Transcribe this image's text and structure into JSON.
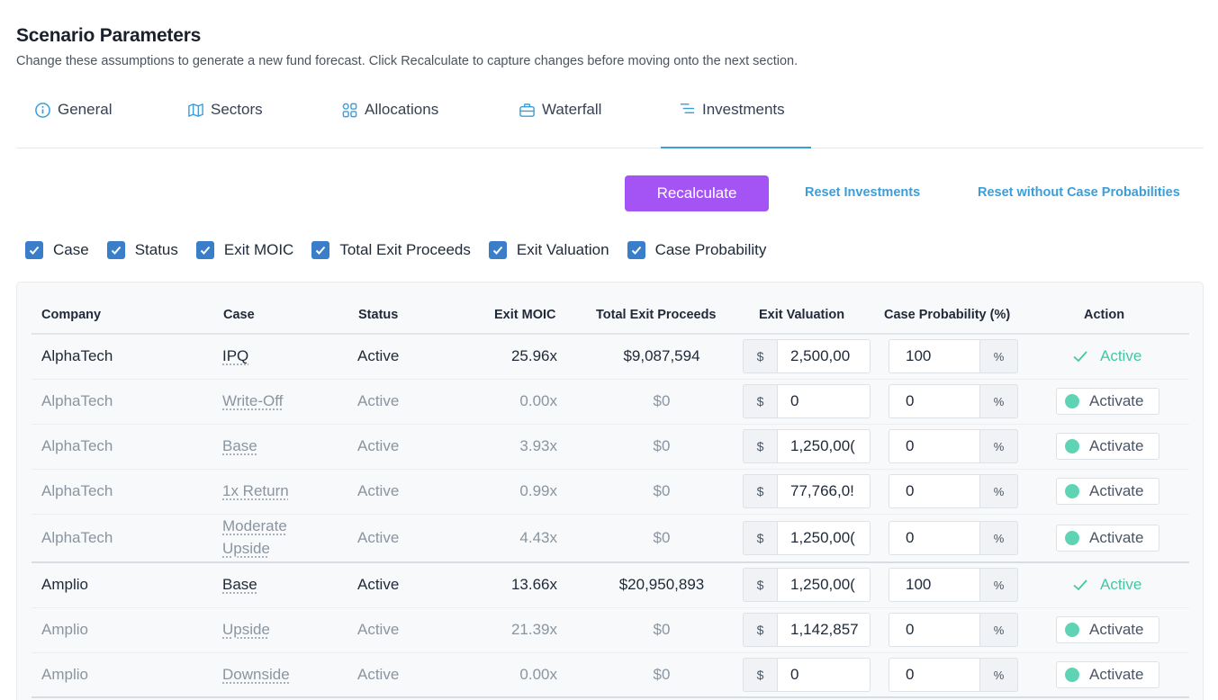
{
  "header": {
    "title": "Scenario Parameters",
    "subtitle": "Change these assumptions to generate a new fund forecast. Click Recalculate to capture changes before moving onto the next section."
  },
  "tabs": [
    {
      "label": "General",
      "icon": "info-icon"
    },
    {
      "label": "Sectors",
      "icon": "map-icon"
    },
    {
      "label": "Allocations",
      "icon": "grid-icon"
    },
    {
      "label": "Waterfall",
      "icon": "briefcase-icon"
    },
    {
      "label": "Investments",
      "icon": "list-icon",
      "active": true
    }
  ],
  "actions": {
    "recalculate": "Recalculate",
    "reset_investments": "Reset Investments",
    "reset_without_probabilities": "Reset without Case Probabilities"
  },
  "filters": [
    "Case",
    "Status",
    "Exit MOIC",
    "Total Exit Proceeds",
    "Exit Valuation",
    "Case Probability"
  ],
  "table": {
    "columns": [
      "Company",
      "Case",
      "Status",
      "Exit MOIC",
      "Total Exit Proceeds",
      "Exit Valuation",
      "Case Probability (%)",
      "Action"
    ],
    "currency_symbol": "$",
    "percent_symbol": "%",
    "active_label": "Active",
    "activate_label": "Activate",
    "rows": [
      {
        "company": "AlphaTech",
        "case": "IPQ",
        "status": "Active",
        "moic": "25.96x",
        "proceeds": "$9,087,594",
        "valuation": "2,500,00",
        "probability": "100"
      },
      {
        "company": "AlphaTech",
        "case": "Write-Off",
        "status": "Active",
        "moic": "0.00x",
        "proceeds": "$0",
        "valuation": "0",
        "probability": "0"
      },
      {
        "company": "AlphaTech",
        "case": "Base",
        "status": "Active",
        "moic": "3.93x",
        "proceeds": "$0",
        "valuation": "1,250,00(",
        "probability": "0"
      },
      {
        "company": "AlphaTech",
        "case": "1x Return",
        "status": "Active",
        "moic": "0.99x",
        "proceeds": "$0",
        "valuation": "77,766,0!",
        "probability": "0"
      },
      {
        "company": "AlphaTech",
        "case_line1": "Moderate",
        "case_line2": "Upside",
        "status": "Active",
        "moic": "4.43x",
        "proceeds": "$0",
        "valuation": "1,250,00(",
        "probability": "0"
      },
      {
        "company": "Amplio",
        "case": "Base",
        "status": "Active",
        "moic": "13.66x",
        "proceeds": "$20,950,893",
        "valuation": "1,250,00(",
        "probability": "100"
      },
      {
        "company": "Amplio",
        "case": "Upside",
        "status": "Active",
        "moic": "21.39x",
        "proceeds": "$0",
        "valuation": "1,142,857",
        "probability": "0"
      },
      {
        "company": "Amplio",
        "case": "Downside",
        "status": "Active",
        "moic": "0.00x",
        "proceeds": "$0",
        "valuation": "0",
        "probability": "0"
      }
    ]
  }
}
